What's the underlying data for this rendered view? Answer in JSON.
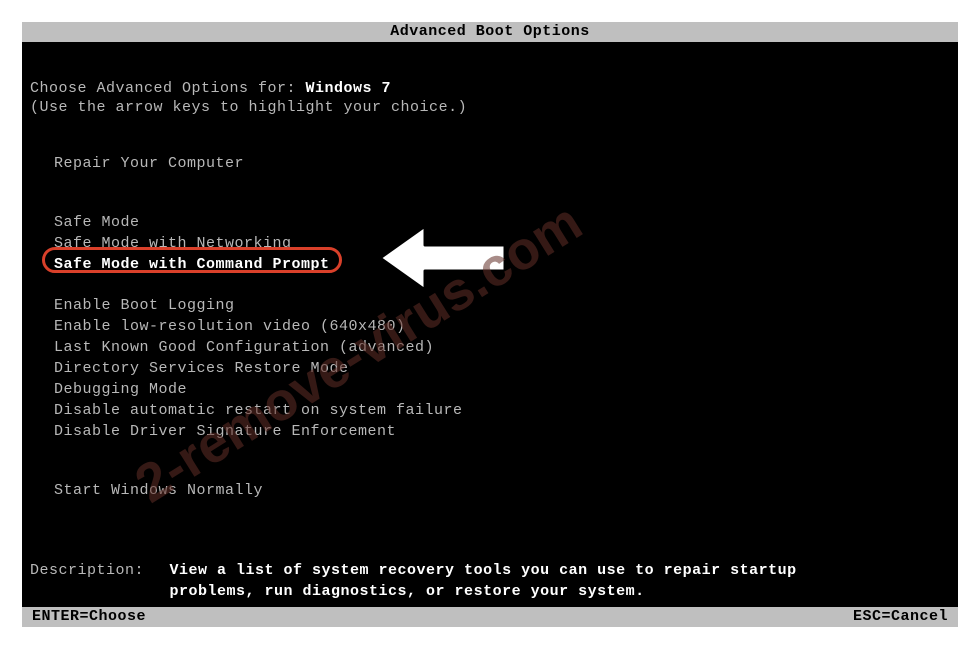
{
  "title": "Advanced Boot Options",
  "prompt_prefix": "Choose Advanced Options for: ",
  "os_name": "Windows 7",
  "hint": "(Use the arrow keys to highlight your choice.)",
  "group0": [
    "Repair Your Computer"
  ],
  "group1": [
    "Safe Mode",
    "Safe Mode with Networking",
    "Safe Mode with Command Prompt"
  ],
  "group2": [
    "Enable Boot Logging",
    "Enable low-resolution video (640x480)",
    "Last Known Good Configuration (advanced)",
    "Directory Services Restore Mode",
    "Debugging Mode",
    "Disable automatic restart on system failure",
    "Disable Driver Signature Enforcement"
  ],
  "group3": [
    "Start Windows Normally"
  ],
  "description_label": "Description:",
  "description_text": "View a list of system recovery tools you can use to repair startup problems, run diagnostics, or restore your system.",
  "footer": {
    "enter": "ENTER=Choose",
    "esc": "ESC=Cancel"
  },
  "watermark": "2-remove-virus.com",
  "annotation": {
    "highlighted_option": "Safe Mode with Command Prompt",
    "arrow_color": "#ffffff",
    "arrow_outline": "#000000",
    "ring_color": "#d9402a"
  }
}
